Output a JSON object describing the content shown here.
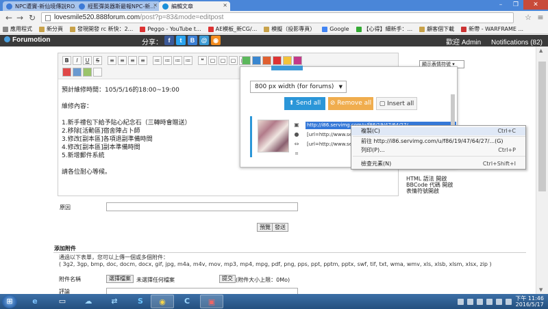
{
  "tabs": [
    {
      "label": "NPC遭竇-新仙境傳說RO..."
    },
    {
      "label": "經藍彈英器斯最報NPC-新..."
    },
    {
      "label": "編輯文章"
    }
  ],
  "address": {
    "host": "lovesmile520.888forum.com",
    "path": "/post?p=83&mode=editpost"
  },
  "bookmarks": [
    "應用程式",
    "新分頁",
    "發現開發 rc 新快：2...",
    "Peggo - YouTube t...",
    "AE模板_新CG/...",
    "模擬（投影專頁）",
    "Google",
    "【心得】細新手：...",
    "顧客個下載",
    "新帶 - WARFRAME ..."
  ],
  "forumotion": {
    "logo": "Forumotion",
    "share": "分享：",
    "welcome": "歡迎 Admin",
    "notifications": "Notifications (82)"
  },
  "social_icons": [
    "facebook-icon",
    "twitter-icon",
    "blogger-icon",
    "at-icon",
    "rss-icon"
  ],
  "social_glyphs": [
    "f",
    "t",
    "B",
    "@",
    "◉"
  ],
  "editor": {
    "toolbar_glyphs": [
      "B",
      "I",
      "U",
      "S",
      "≡",
      "≡",
      "≡",
      "≡",
      "≔",
      "≔",
      "≔",
      "≔",
      "❝",
      "▢",
      "▢",
      "▢",
      "▢"
    ],
    "lines": [
      "預計維修時間：105/5/16的18:00~19:00",
      "",
      "維修內容：",
      "",
      "1.新手禮包下給予貼心紀念石（三轉時會贈送）",
      "2.移除[活動區]宿舍陣占卜師",
      "3.修改[副本區]各項退副準備時間",
      "4.修改[副本區]副本準備時間",
      "5.新增郵件系統",
      "",
      "請各位耐心等候。"
    ]
  },
  "side_select": "顯示表情符號 ▾",
  "side_links": [
    "HTML 語法 開啟",
    "BBCode 代碼 開啟",
    "表情符號開啟"
  ],
  "upload_popup": {
    "size_option": "800 px width (for forums)",
    "send_all": "Send all",
    "remove_all": "Remove all",
    "insert_all": "Insert all",
    "fields": [
      "http://i86.servimg.com/u/f86/19/47/64/27/...",
      "[url=http://www.servimg.com/",
      "[url=http://www.servimg.com/"
    ]
  },
  "context_menu": [
    {
      "label": "複製(C)",
      "shortcut": "Ctrl+C"
    },
    {
      "label": "前往 http://i86.servimg.com/u/f86/19/47/64/27/...(G)",
      "shortcut": ""
    },
    {
      "label": "列印(P)...",
      "shortcut": "Ctrl+P"
    },
    {
      "label": "檢查元素(N)",
      "shortcut": "Ctrl+Shift+I"
    }
  ],
  "form": {
    "reason_label": "原因",
    "preview": "預覽",
    "submit": "發送",
    "attach_title": "添加附件",
    "attach_note_1": "通過以下表單，您可以上傳一個或多個附件：",
    "attach_note_2": "( 3g2, 3gp, bmp, doc, docm, docx, gif, jpg, m4a, m4v, mov, mp3, mp4, mpg, pdf, png, pps, ppt, pptm, pptx, swf, tif, txt, wma, wmv, xls, xlsb, xlsm, xlsx, zip )",
    "file_label": "附件名稱",
    "choose_file": "選擇檔案",
    "no_file": "未選擇任何檔案",
    "upload": "提交",
    "size_limit": "(附件大小上限：0Mo)",
    "comment_label": "評論"
  },
  "taskbar": {
    "apps": [
      "ie-icon",
      "cloud-icon",
      "teamviewer-icon",
      "skype-icon",
      "chrome-icon",
      "c-app-icon",
      "game-icon"
    ],
    "clock_time": "下午 11:46",
    "clock_date": "2016/5/17"
  }
}
